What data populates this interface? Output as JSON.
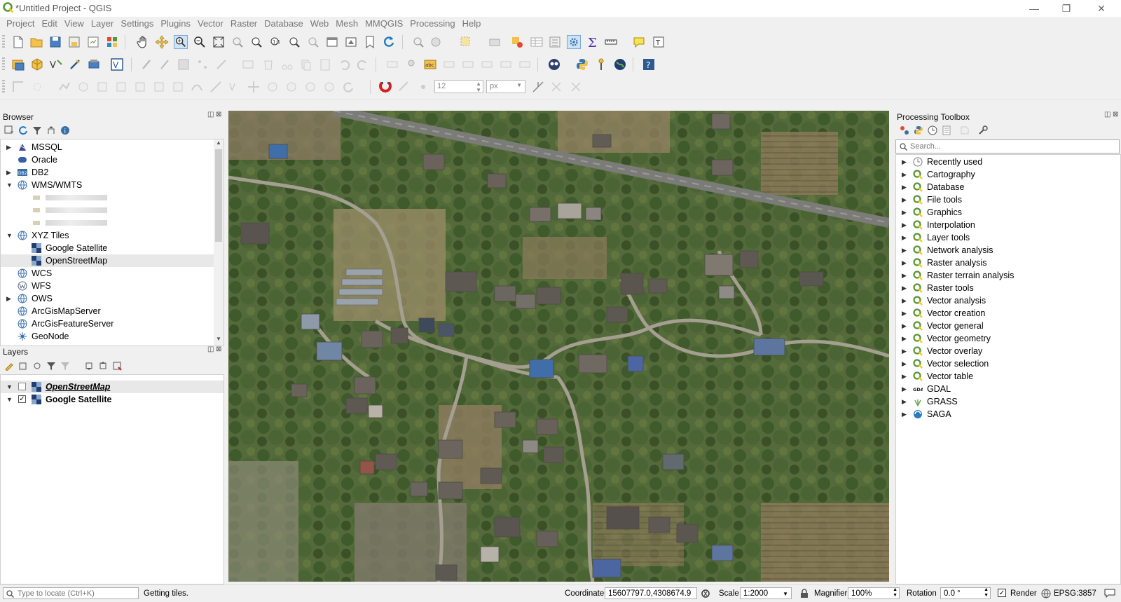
{
  "window": {
    "title": "*Untitled Project - QGIS",
    "minimize": "—",
    "restore": "❐",
    "close": "✕"
  },
  "menu": [
    "Project",
    "Edit",
    "View",
    "Layer",
    "Settings",
    "Plugins",
    "Vector",
    "Raster",
    "Database",
    "Web",
    "Mesh",
    "MMQGIS",
    "Processing",
    "Help"
  ],
  "toolbar": {
    "font_size_value": "12",
    "unit_value": "px"
  },
  "browser": {
    "title": "Browser",
    "items": [
      {
        "label": "MSSQL",
        "icon": "mssql-icon",
        "expander": "closed",
        "indent": 0
      },
      {
        "label": "Oracle",
        "icon": "oracle-icon",
        "expander": "none",
        "indent": 0
      },
      {
        "label": "DB2",
        "icon": "db2-icon",
        "expander": "closed",
        "indent": 0
      },
      {
        "label": "WMS/WMTS",
        "icon": "globe-icon",
        "expander": "open",
        "indent": 0
      },
      {
        "label": "",
        "icon": "blurred-icon",
        "expander": "none",
        "indent": 1
      },
      {
        "label": "",
        "icon": "blurred-icon",
        "expander": "none",
        "indent": 1
      },
      {
        "label": "",
        "icon": "blurred-icon",
        "expander": "none",
        "indent": 1
      },
      {
        "label": "XYZ Tiles",
        "icon": "globe-icon",
        "expander": "open",
        "indent": 0
      },
      {
        "label": "Google Satellite",
        "icon": "tile-icon",
        "expander": "none",
        "indent": 1
      },
      {
        "label": "OpenStreetMap",
        "icon": "tile-icon",
        "expander": "none",
        "indent": 1
      },
      {
        "label": "WCS",
        "icon": "globe-icon",
        "expander": "none",
        "indent": 0
      },
      {
        "label": "WFS",
        "icon": "wfs-icon",
        "expander": "none",
        "indent": 0
      },
      {
        "label": "OWS",
        "icon": "globe-icon",
        "expander": "closed",
        "indent": 0
      },
      {
        "label": "ArcGisMapServer",
        "icon": "globe-icon",
        "expander": "none",
        "indent": 0
      },
      {
        "label": "ArcGisFeatureServer",
        "icon": "globe-icon",
        "expander": "none",
        "indent": 0
      },
      {
        "label": "GeoNode",
        "icon": "geonode-icon",
        "expander": "none",
        "indent": 0
      }
    ]
  },
  "layers": {
    "title": "Layers",
    "items": [
      {
        "label": "OpenStreetMap",
        "checked": false,
        "style": "italic-underline"
      },
      {
        "label": "Google Satellite",
        "checked": true,
        "style": "bold"
      }
    ]
  },
  "processing": {
    "title": "Processing Toolbox",
    "search_placeholder": "Search...",
    "items": [
      {
        "label": "Recently used",
        "icon": "clock-icon"
      },
      {
        "label": "Cartography",
        "icon": "qgis-icon"
      },
      {
        "label": "Database",
        "icon": "qgis-icon"
      },
      {
        "label": "File tools",
        "icon": "qgis-icon"
      },
      {
        "label": "Graphics",
        "icon": "qgis-icon"
      },
      {
        "label": "Interpolation",
        "icon": "qgis-icon"
      },
      {
        "label": "Layer tools",
        "icon": "qgis-icon"
      },
      {
        "label": "Network analysis",
        "icon": "qgis-icon"
      },
      {
        "label": "Raster analysis",
        "icon": "qgis-icon"
      },
      {
        "label": "Raster terrain analysis",
        "icon": "qgis-icon"
      },
      {
        "label": "Raster tools",
        "icon": "qgis-icon"
      },
      {
        "label": "Vector analysis",
        "icon": "qgis-icon"
      },
      {
        "label": "Vector creation",
        "icon": "qgis-icon"
      },
      {
        "label": "Vector general",
        "icon": "qgis-icon"
      },
      {
        "label": "Vector geometry",
        "icon": "qgis-icon"
      },
      {
        "label": "Vector overlay",
        "icon": "qgis-icon"
      },
      {
        "label": "Vector selection",
        "icon": "qgis-icon"
      },
      {
        "label": "Vector table",
        "icon": "qgis-icon"
      },
      {
        "label": "GDAL",
        "icon": "gdal-icon"
      },
      {
        "label": "GRASS",
        "icon": "grass-icon"
      },
      {
        "label": "SAGA",
        "icon": "saga-icon"
      }
    ]
  },
  "status": {
    "locate_placeholder": "Type to locate (Ctrl+K)",
    "message": "Getting tiles.",
    "coordinate_label": "Coordinate",
    "coordinate_value": "15607797.0,4308674.9",
    "scale_label": "Scale",
    "scale_value": "1:2000",
    "magnifier_label": "Magnifier",
    "magnifier_value": "100%",
    "rotation_label": "Rotation",
    "rotation_value": "0.0 °",
    "render_label": "Render",
    "crs": "EPSG:3857"
  },
  "colors": {
    "accent": "#589632",
    "map_bg": "#55663c",
    "road": "#8a8a8a"
  }
}
